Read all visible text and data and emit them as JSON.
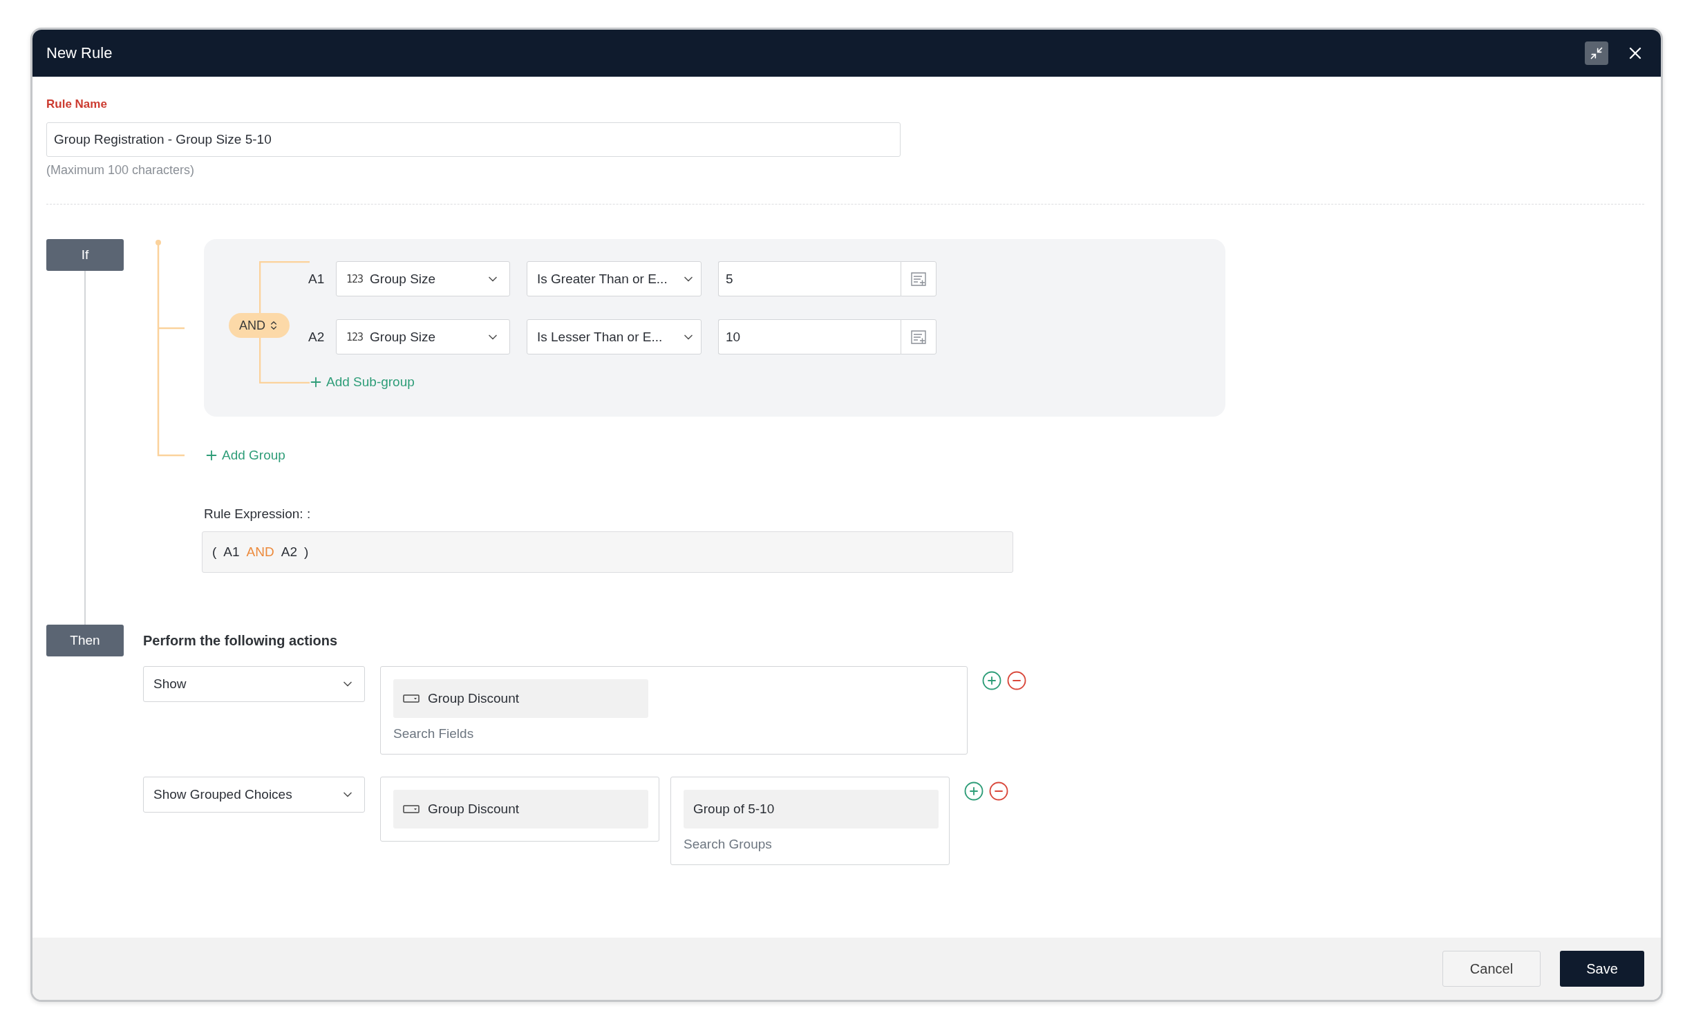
{
  "window": {
    "title": "New Rule"
  },
  "rule_name": {
    "label": "Rule Name",
    "value": "Group Registration - Group Size 5-10",
    "hint": "(Maximum 100 characters)"
  },
  "if_section": {
    "badge": "If",
    "group": {
      "joiner": "AND",
      "conditions": [
        {
          "label": "A1",
          "type_label": "123",
          "field": "Group Size",
          "operator": "Is Greater Than or E...",
          "value": "5"
        },
        {
          "label": "A2",
          "type_label": "123",
          "field": "Group Size",
          "operator": "Is Lesser Than or E...",
          "value": "10"
        }
      ],
      "add_subgroup": "Add Sub-group"
    },
    "add_group": "Add Group",
    "expression": {
      "label": "Rule Expression: :",
      "tokens": [
        {
          "kind": "paren",
          "text": "("
        },
        {
          "kind": "operand",
          "text": "A1"
        },
        {
          "kind": "operator",
          "text": "AND"
        },
        {
          "kind": "operand",
          "text": "A2"
        },
        {
          "kind": "paren",
          "text": ")"
        }
      ]
    }
  },
  "then_section": {
    "badge": "Then",
    "heading": "Perform the following actions",
    "actions": [
      {
        "kind": "fields",
        "action": "Show",
        "fields": [
          "Group Discount"
        ],
        "fields_placeholder": "Search Fields"
      },
      {
        "kind": "grouped",
        "action": "Show Grouped Choices",
        "fields": [
          "Group Discount"
        ],
        "groups": [
          "Group of 5-10"
        ],
        "groups_placeholder": "Search Groups"
      }
    ]
  },
  "footer": {
    "cancel": "Cancel",
    "save": "Save"
  }
}
